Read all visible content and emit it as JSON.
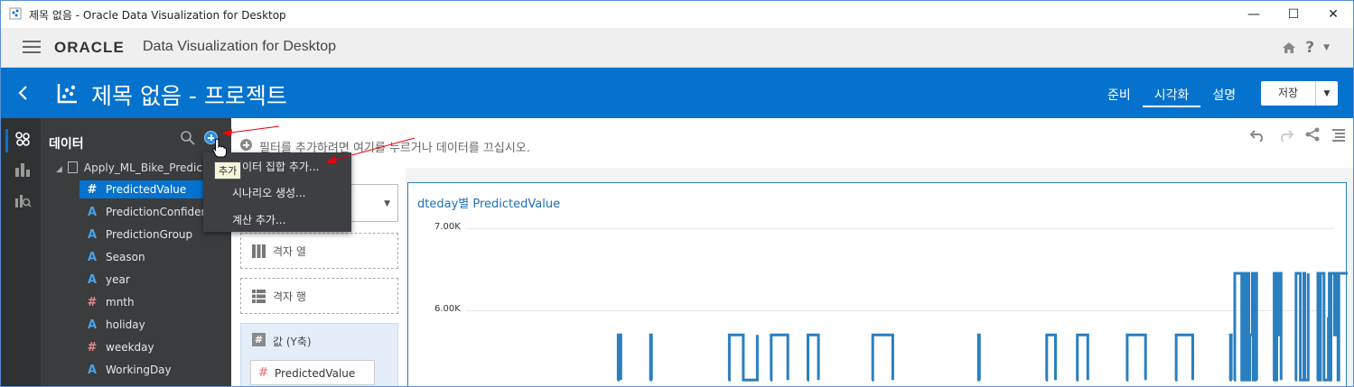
{
  "window": {
    "title": "제목 없음 - Oracle Data Visualization for Desktop",
    "minimize_glyph": "—",
    "maximize_glyph": "☐",
    "close_glyph": "✕"
  },
  "header": {
    "logo": "ORACLE",
    "product": "Data Visualization for Desktop",
    "icons": [
      "home-icon",
      "help-icon",
      "chevron-down-icon"
    ]
  },
  "project": {
    "title": "제목 없음 - 프로젝트",
    "nav": [
      {
        "label": "준비",
        "active": false
      },
      {
        "label": "시각화",
        "active": true
      },
      {
        "label": "설명",
        "active": false
      }
    ],
    "save_label": "저장"
  },
  "data_panel": {
    "title": "데이터",
    "dataset": "Apply_ML_Bike_Predic",
    "columns": [
      {
        "type": "#",
        "name": "PredictedValue",
        "selected": true
      },
      {
        "type": "A",
        "name": "PredictionConfidenc",
        "selected": false
      },
      {
        "type": "A",
        "name": "PredictionGroup",
        "selected": false
      },
      {
        "type": "A",
        "name": "Season",
        "selected": false
      },
      {
        "type": "A",
        "name": "year",
        "selected": false
      },
      {
        "type": "#",
        "name": "mnth",
        "selected": false
      },
      {
        "type": "A",
        "name": "holiday",
        "selected": false
      },
      {
        "type": "#",
        "name": "weekday",
        "selected": false
      },
      {
        "type": "A",
        "name": "WorkingDay",
        "selected": false
      }
    ]
  },
  "filter_bar": {
    "hint": "필터를 추가하려면 여기를 누르거나 데이터를 끄십시오."
  },
  "context_menu": {
    "items": [
      "데이터 집합 추가...",
      "시나리오 생성...",
      "계산 추가..."
    ],
    "tooltip": "추가"
  },
  "grammar": {
    "grid_columns": "격자 열",
    "grid_rows": "격자 행",
    "values_label": "값 (Y축)",
    "values_pill": "PredictedValue"
  },
  "colors": {
    "brand_blue": "#0572ce",
    "line": "#2a7fc0"
  },
  "chart_data": {
    "type": "line",
    "title": "dteday별 PredictedValue",
    "ytick_labels": [
      "7.00K",
      "6.00K"
    ],
    "ylim_visible": [
      5150,
      7000
    ],
    "segments": [
      {
        "x": [
          0.175,
          0.176,
          0.178,
          0.179
        ],
        "y": [
          5150,
          5700,
          5700,
          5150
        ]
      },
      {
        "x": [
          0.212,
          0.213,
          0.214
        ],
        "y": [
          5150,
          5700,
          5150
        ]
      },
      {
        "x": [
          0.302,
          0.303,
          0.318,
          0.319,
          0.334,
          0.335
        ],
        "y": [
          5150,
          5700,
          5700,
          5150,
          5150,
          5700
        ]
      },
      {
        "x": [
          0.35,
          0.351,
          0.369,
          0.37
        ],
        "y": [
          5150,
          5700,
          5700,
          5150
        ]
      },
      {
        "x": [
          0.392,
          0.393,
          0.404,
          0.405
        ],
        "y": [
          5150,
          5700,
          5700,
          5150
        ]
      },
      {
        "x": [
          0.466,
          0.467,
          0.489,
          0.49
        ],
        "y": [
          5150,
          5700,
          5700,
          5150
        ]
      },
      {
        "x": [
          0.587,
          0.588,
          0.589
        ],
        "y": [
          5150,
          5700,
          5150
        ]
      },
      {
        "x": [
          0.665,
          0.666,
          0.675,
          0.676
        ],
        "y": [
          5150,
          5700,
          5700,
          5150
        ]
      },
      {
        "x": [
          0.7,
          0.701,
          0.712,
          0.713
        ],
        "y": [
          5150,
          5700,
          5700,
          5150
        ]
      },
      {
        "x": [
          0.757,
          0.758,
          0.778,
          0.779
        ],
        "y": [
          5150,
          5700,
          5700,
          5150
        ]
      },
      {
        "x": [
          0.813,
          0.814,
          0.832,
          0.833
        ],
        "y": [
          5150,
          5700,
          5700,
          5150
        ]
      },
      {
        "x": [
          0.875,
          0.876,
          0.877
        ],
        "y": [
          5150,
          5700,
          5150
        ]
      },
      {
        "x": [
          0.88,
          0.881,
          0.889,
          0.89,
          0.893,
          0.894,
          0.897,
          0.898,
          0.901,
          0.902,
          0.905,
          0.906
        ],
        "y": [
          5150,
          6450,
          5150,
          6450,
          5150,
          6450,
          5150,
          5700,
          6450,
          5150,
          6450,
          5150
        ]
      },
      {
        "x": [
          0.925,
          0.926,
          0.928,
          0.929,
          0.931,
          0.932,
          0.934
        ],
        "y": [
          5150,
          6450,
          5150,
          6450,
          5700,
          6450,
          5150
        ]
      },
      {
        "x": [
          0.95,
          0.951,
          0.955,
          0.956,
          0.96,
          0.961,
          0.965
        ],
        "y": [
          5150,
          6450,
          6450,
          5150,
          6450,
          5150,
          6450
        ]
      },
      {
        "x": [
          0.975,
          0.976,
          0.978,
          0.979,
          0.982,
          0.983,
          0.988,
          0.989,
          0.99,
          0.991,
          0.994,
          0.995,
          0.998,
          0.999,
          1.0
        ],
        "y": [
          5150,
          6450,
          5150,
          6450,
          6450,
          5150,
          5900,
          6450,
          5150,
          6450,
          6450,
          5700,
          6450,
          5150,
          6450
        ]
      },
      {
        "x": [
          1.0,
          1.001,
          1.02,
          1.021,
          1.03,
          1.031,
          1.04,
          1.041
        ],
        "y": [
          6450,
          6450,
          6450,
          5150,
          6450,
          5150,
          6450,
          5150
        ]
      }
    ]
  }
}
